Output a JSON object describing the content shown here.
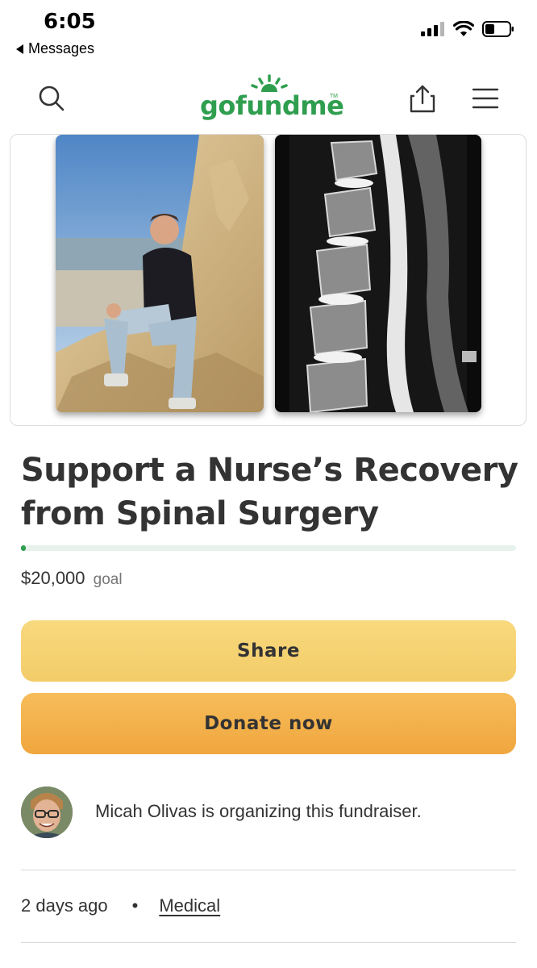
{
  "status_bar": {
    "time": "6:05",
    "back_app": "Messages",
    "icons": [
      "cellular-signal-icon",
      "wifi-icon",
      "battery-icon"
    ]
  },
  "header": {
    "logo_text": "gofundme",
    "logo_tm": "TM",
    "icons": [
      "search-icon",
      "share-upload-icon",
      "menu-icon"
    ],
    "brand_color": "#2f9e4f"
  },
  "hero": {
    "images": [
      "photo of man sitting on beach cliff",
      "MRI scan of lumbar spine"
    ]
  },
  "campaign": {
    "title": "Support a Nurse’s Recovery from Spinal Surgery",
    "goal_amount": "$20,000",
    "goal_word": "goal",
    "progress_fraction": 0.01
  },
  "buttons": {
    "share_label": "Share",
    "donate_label": "Donate now"
  },
  "organizer": {
    "text": "Micah Olivas is organizing this fundraiser."
  },
  "meta": {
    "posted": "2 days ago",
    "separator": "•",
    "category": "Medical"
  }
}
